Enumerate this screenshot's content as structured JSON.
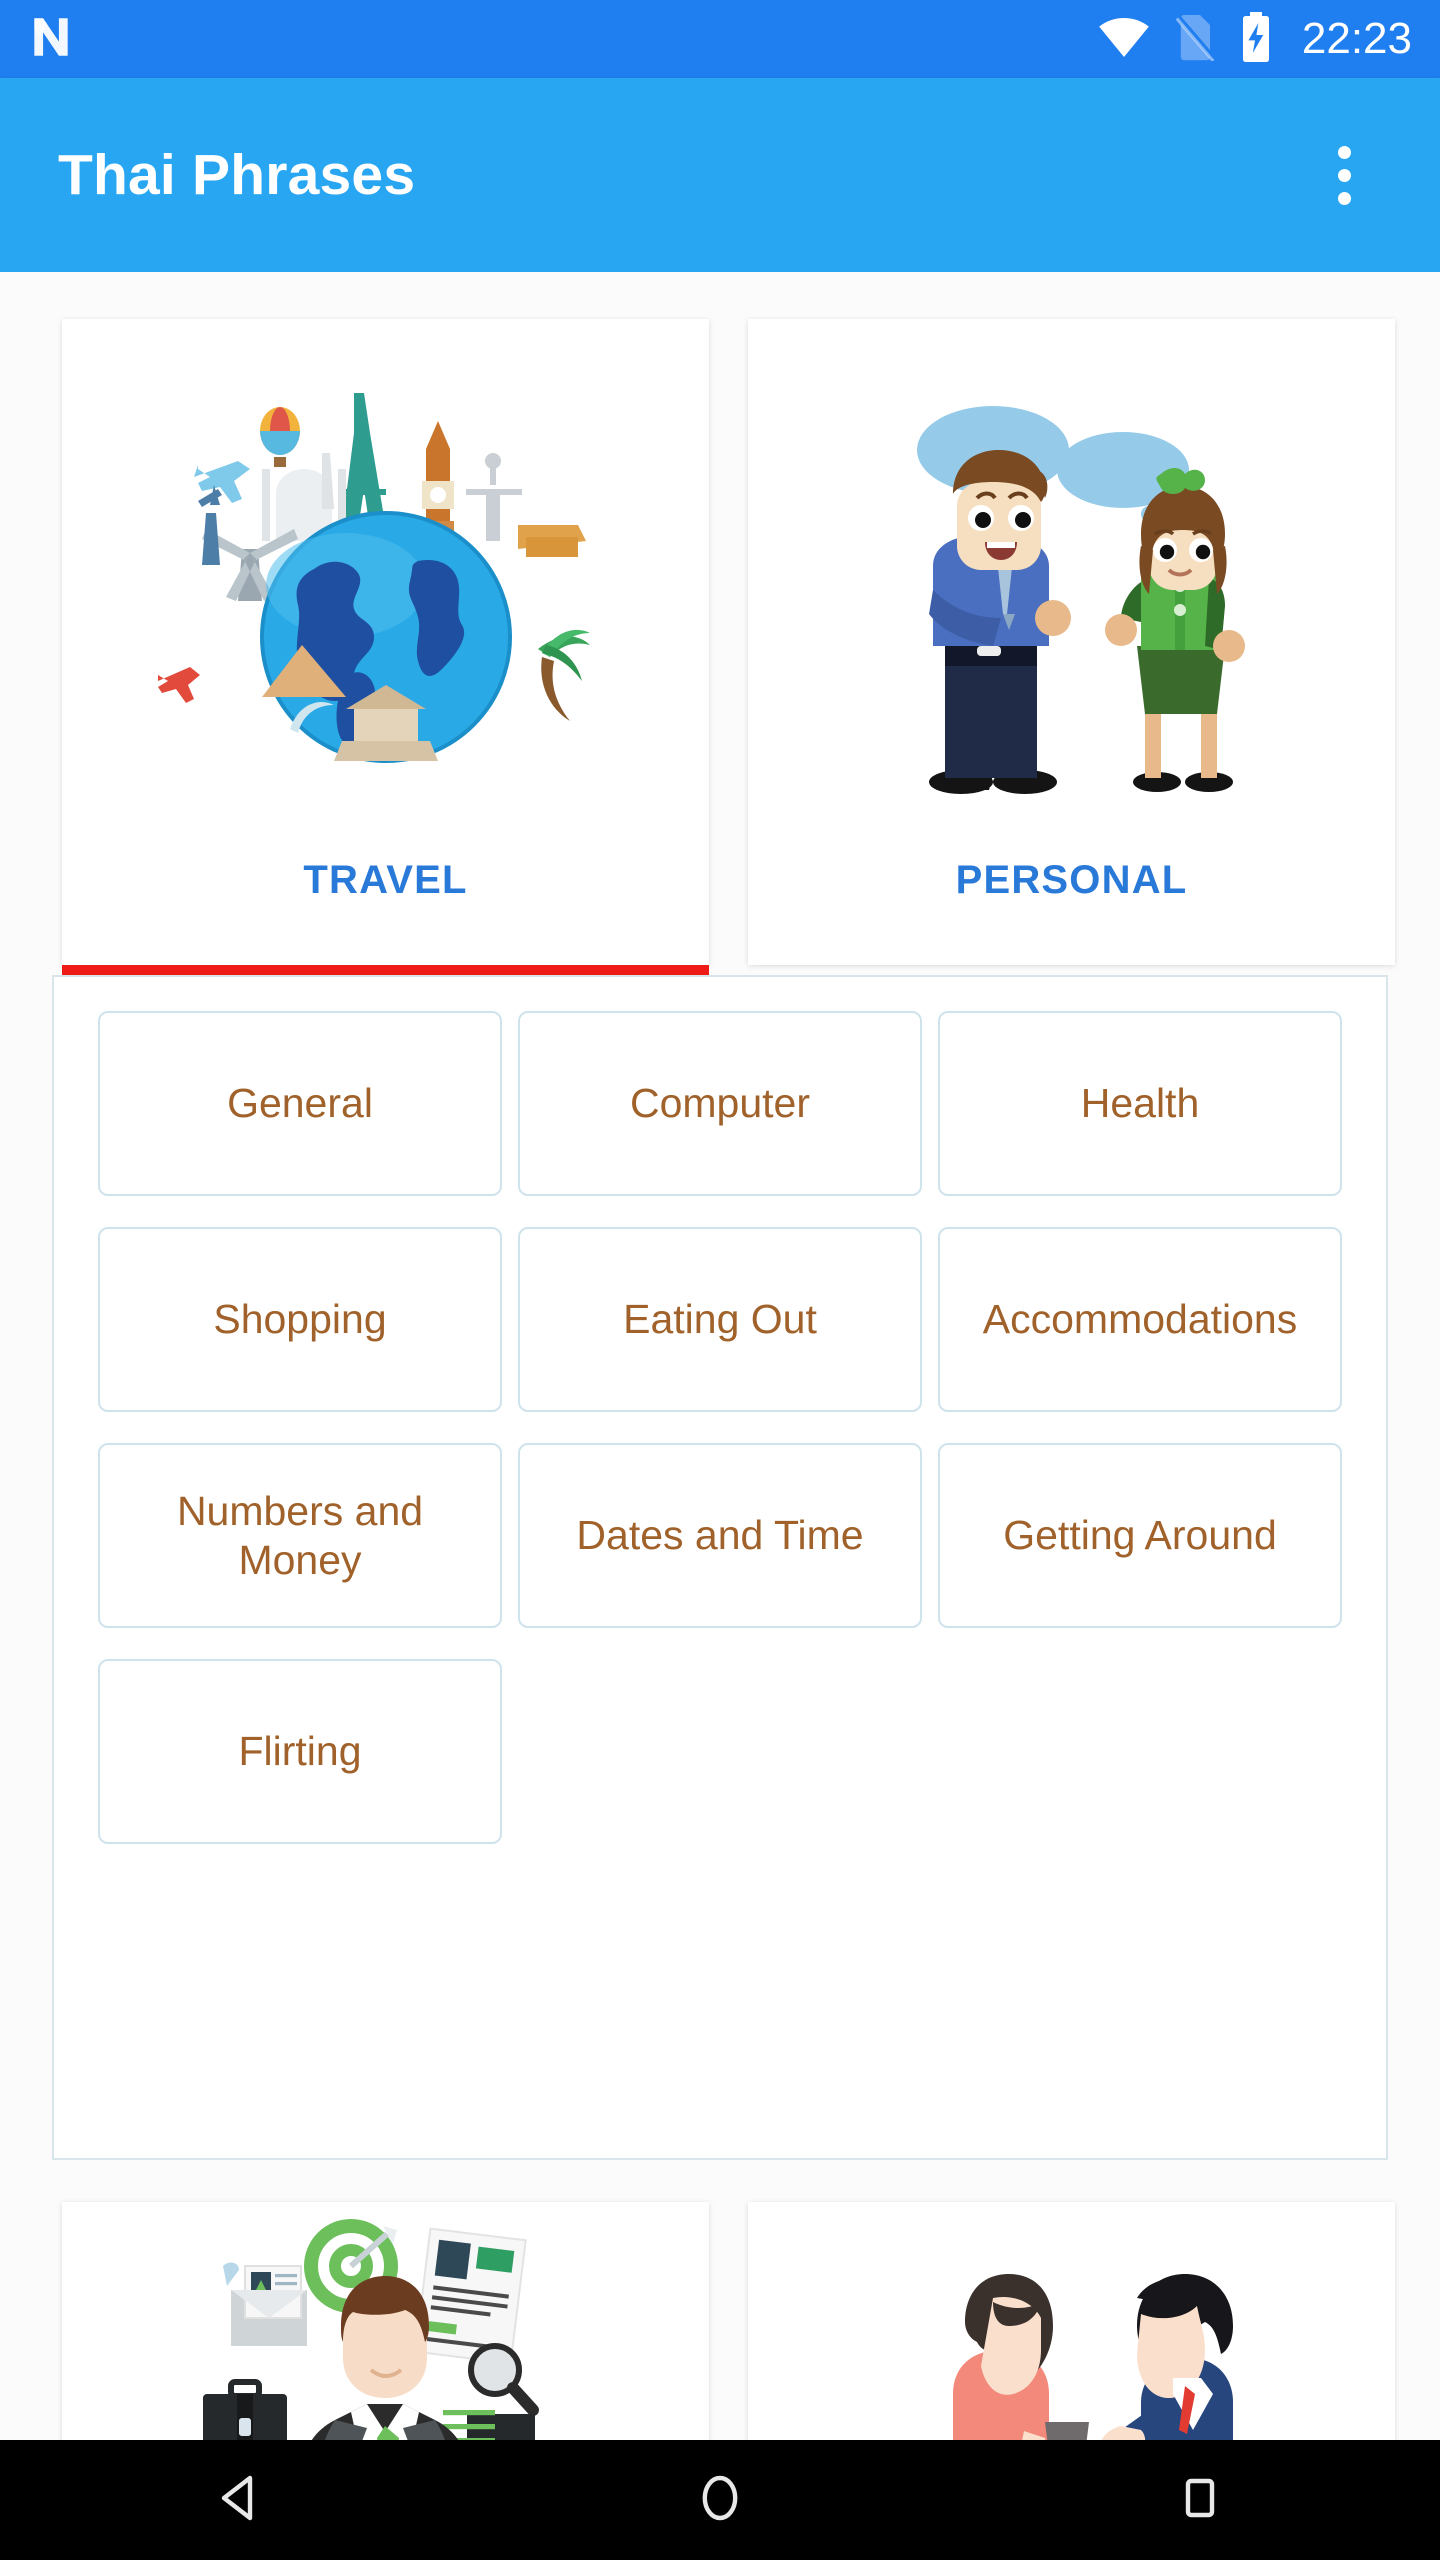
{
  "statusbar": {
    "time": "22:23",
    "icons": [
      "android-n-logo",
      "wifi-icon",
      "no-sim-icon",
      "battery-charging-icon"
    ]
  },
  "appbar": {
    "title": "Thai Phrases",
    "overflow_label": "More options",
    "background": "#29a6f2"
  },
  "theme": {
    "status_bar": "#1f7ef0",
    "app_bar": "#29a6f2",
    "tab_label": "#2979d8",
    "tab_indicator": "#ee1b17",
    "tile_text": "#a0622a",
    "tile_border": "#cfe3ec",
    "panel_border": "#d8e5ea",
    "page_background": "#fbfbfb"
  },
  "tabs": [
    {
      "label": "TRAVEL",
      "icon": "globe-landmarks-illustration",
      "selected": true
    },
    {
      "label": "PERSONAL",
      "icon": "two-people-talking-illustration",
      "selected": false
    }
  ],
  "categories": [
    {
      "label": "General"
    },
    {
      "label": "Computer"
    },
    {
      "label": "Health"
    },
    {
      "label": "Shopping"
    },
    {
      "label": "Eating Out"
    },
    {
      "label": "Accommodations"
    },
    {
      "label": "Numbers and Money"
    },
    {
      "label": "Dates and Time"
    },
    {
      "label": "Getting Around"
    },
    {
      "label": "Flirting"
    }
  ],
  "bottom_cards": [
    {
      "icon": "businessman-job-search-illustration"
    },
    {
      "icon": "two-men-business-meeting-illustration"
    }
  ],
  "navbar": {
    "buttons": [
      {
        "name": "back",
        "icon": "back-triangle-icon"
      },
      {
        "name": "home",
        "icon": "home-circle-icon"
      },
      {
        "name": "recents",
        "icon": "recents-square-icon"
      }
    ]
  }
}
